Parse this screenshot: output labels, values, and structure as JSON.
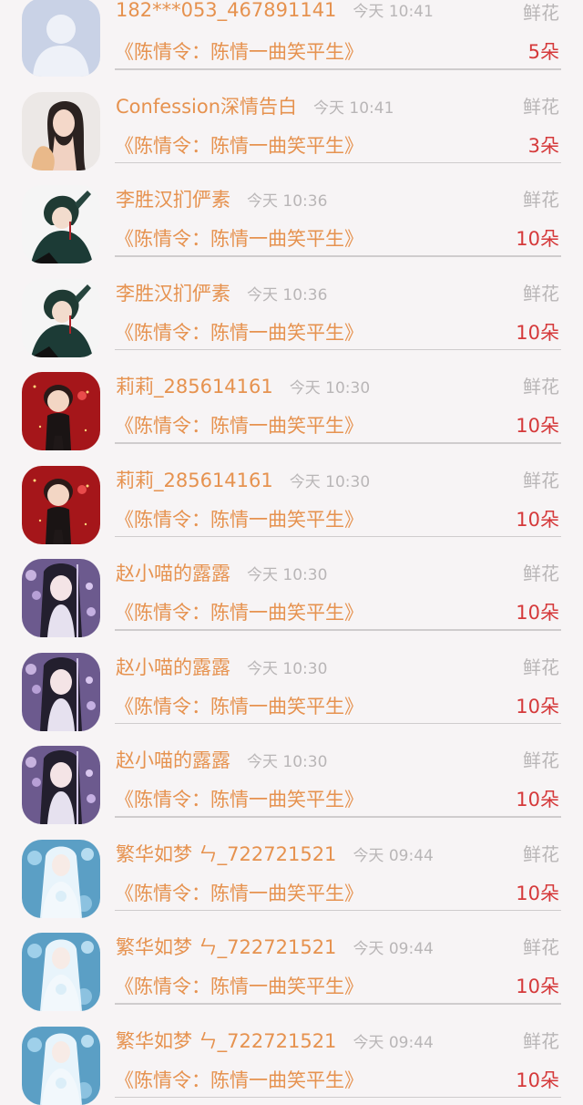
{
  "rows": [
    {
      "name": "182***053_467891141",
      "time": "今天 10:41",
      "gift": "鲜花",
      "song": "《陈情令：陈情一曲笑平生》",
      "count": "5朵",
      "avatar": "default-user-avatar"
    },
    {
      "name": "Confession深情告白",
      "time": "今天 10:41",
      "gift": "鲜花",
      "song": "《陈情令：陈情一曲笑平生》",
      "count": "3朵",
      "avatar": "girl-photo-avatar"
    },
    {
      "name": "李胜汉扪俨素",
      "time": "今天 10:36",
      "gift": "鲜花",
      "song": "《陈情令：陈情一曲笑平生》",
      "count": "10朵",
      "avatar": "anime-boy-avatar"
    },
    {
      "name": "李胜汉扪俨素",
      "time": "今天 10:36",
      "gift": "鲜花",
      "song": "《陈情令：陈情一曲笑平生》",
      "count": "10朵",
      "avatar": "anime-boy-avatar"
    },
    {
      "name": "莉莉_285614161",
      "time": "今天 10:30",
      "gift": "鲜花",
      "song": "《陈情令：陈情一曲笑平生》",
      "count": "10朵",
      "avatar": "chibi-red-avatar"
    },
    {
      "name": "莉莉_285614161",
      "time": "今天 10:30",
      "gift": "鲜花",
      "song": "《陈情令：陈情一曲笑平生》",
      "count": "10朵",
      "avatar": "chibi-red-avatar"
    },
    {
      "name": "赵小喵的露露",
      "time": "今天 10:30",
      "gift": "鲜花",
      "song": "《陈情令：陈情一曲笑平生》",
      "count": "10朵",
      "avatar": "anime-girl-purple-avatar"
    },
    {
      "name": "赵小喵的露露",
      "time": "今天 10:30",
      "gift": "鲜花",
      "song": "《陈情令：陈情一曲笑平生》",
      "count": "10朵",
      "avatar": "anime-girl-purple-avatar"
    },
    {
      "name": "赵小喵的露露",
      "time": "今天 10:30",
      "gift": "鲜花",
      "song": "《陈情令：陈情一曲笑平生》",
      "count": "10朵",
      "avatar": "anime-girl-purple-avatar"
    },
    {
      "name": "繁华如梦 ㄣ_722721521",
      "time": "今天 09:44",
      "gift": "鲜花",
      "song": "《陈情令：陈情一曲笑平生》",
      "count": "10朵",
      "avatar": "anime-bride-blue-avatar"
    },
    {
      "name": "繁华如梦 ㄣ_722721521",
      "time": "今天 09:44",
      "gift": "鲜花",
      "song": "《陈情令：陈情一曲笑平生》",
      "count": "10朵",
      "avatar": "anime-bride-blue-avatar"
    },
    {
      "name": "繁华如梦 ㄣ_722721521",
      "time": "今天 09:44",
      "gift": "鲜花",
      "song": "《陈情令：陈情一曲笑平生》",
      "count": "10朵",
      "avatar": "anime-bride-blue-avatar"
    }
  ],
  "colors": {
    "accent_orange": "#e6924f",
    "count_red": "#d5393a",
    "muted_gray": "#b9b6b7",
    "background": "#f7f4f5"
  }
}
